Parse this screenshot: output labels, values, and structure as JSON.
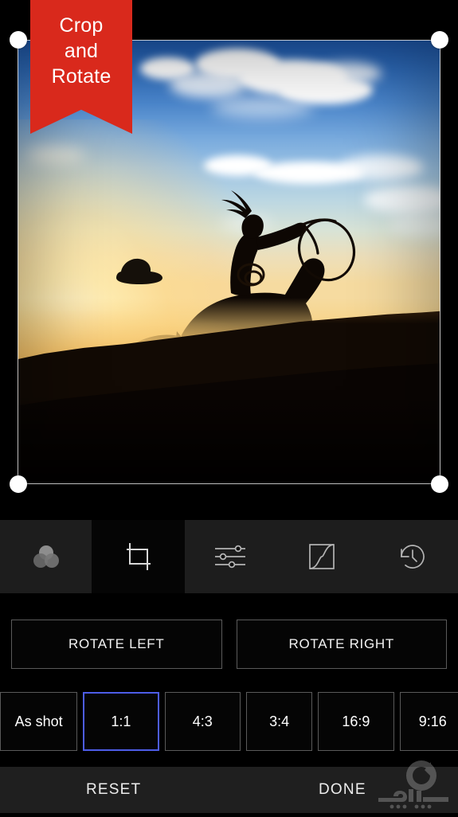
{
  "app": {
    "title": "Crop and Rotate",
    "banner_lines": [
      "Crop",
      "and",
      "Rotate"
    ],
    "banner_color": "#d9291c"
  },
  "photo": {
    "alt": "Silhouette of a cowgirl riding a galloping horse swinging a lasso at sunset",
    "sky_top_color": "#1d56a8",
    "sun_color": "#fff4cd",
    "ground_color": "#120a04"
  },
  "crop": {
    "frame_color": "#e1e1e1",
    "handle_color": "#ffffff",
    "handles": [
      "top-left",
      "top-right",
      "bottom-left",
      "bottom-right"
    ]
  },
  "toolbar": {
    "selected": "crop",
    "items": [
      {
        "id": "looks",
        "icon": "filters-icon",
        "selected": false
      },
      {
        "id": "crop",
        "icon": "crop-icon",
        "selected": true
      },
      {
        "id": "tune",
        "icon": "sliders-icon",
        "selected": false
      },
      {
        "id": "curves",
        "icon": "curves-icon",
        "selected": false
      },
      {
        "id": "history",
        "icon": "history-icon",
        "selected": false
      }
    ]
  },
  "rotate": {
    "left_label": "ROTATE LEFT",
    "right_label": "ROTATE RIGHT"
  },
  "aspect_ratios": {
    "selected": "1:1",
    "selected_color": "#4d5de8",
    "options": [
      {
        "label": "As shot",
        "selected": false
      },
      {
        "label": "1:1",
        "selected": true
      },
      {
        "label": "4:3",
        "selected": false
      },
      {
        "label": "3:4",
        "selected": false
      },
      {
        "label": "16:9",
        "selected": false
      },
      {
        "label": "9:16",
        "selected": false
      }
    ]
  },
  "bottom_bar": {
    "reset_label": "RESET",
    "done_label": "DONE",
    "watermark": "sazeha-logo"
  }
}
